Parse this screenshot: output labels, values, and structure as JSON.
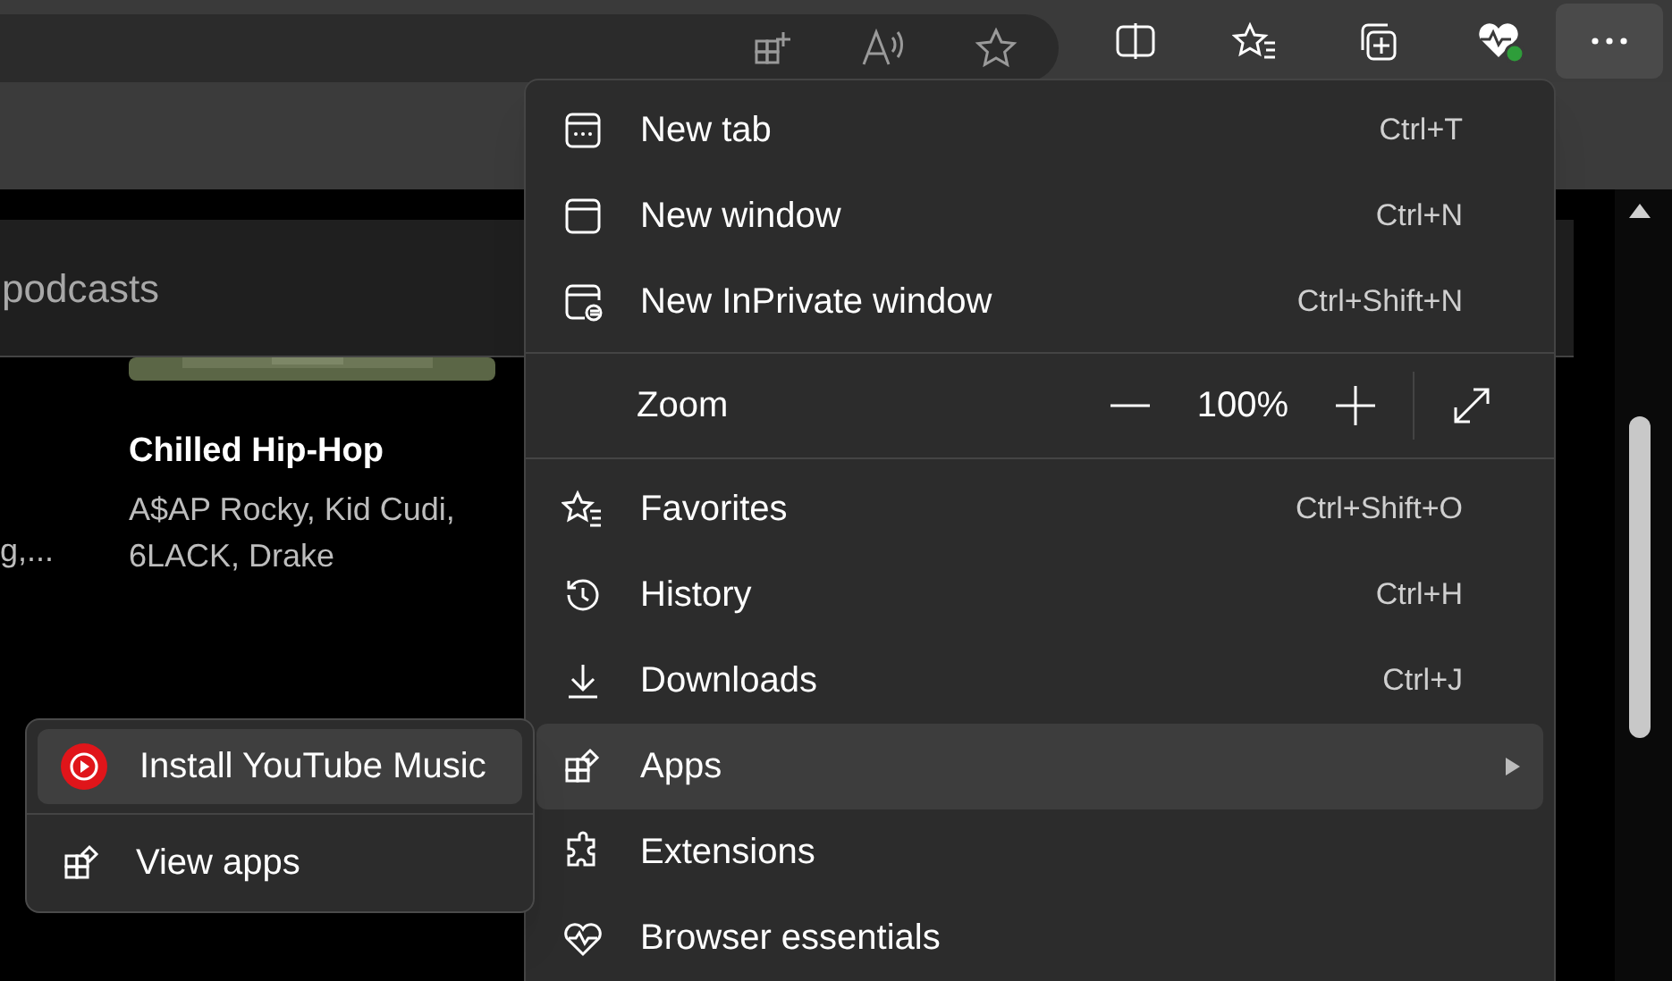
{
  "toolbar": {
    "more_button": {
      "selected": true
    }
  },
  "page": {
    "search_text": "podcasts",
    "cut_text": "g,...",
    "card": {
      "title": "Chilled Hip-Hop",
      "subtitle": "A$AP Rocky, Kid Cudi, 6LACK, Drake"
    }
  },
  "menu": {
    "groups": [
      [
        {
          "kind": "item",
          "label": "New tab",
          "shortcut": "Ctrl+T",
          "selected": false
        },
        {
          "kind": "item",
          "label": "New window",
          "shortcut": "Ctrl+N",
          "selected": false
        },
        {
          "kind": "item",
          "label": "New InPrivate window",
          "shortcut": "Ctrl+Shift+N",
          "selected": false
        }
      ],
      [
        {
          "kind": "zoom",
          "label": "Zoom",
          "value": "100%",
          "selected": false
        }
      ],
      [
        {
          "kind": "item",
          "label": "Favorites",
          "shortcut": "Ctrl+Shift+O",
          "selected": false
        },
        {
          "kind": "item",
          "label": "History",
          "shortcut": "Ctrl+H",
          "selected": false
        },
        {
          "kind": "item",
          "label": "Downloads",
          "shortcut": "Ctrl+J",
          "selected": false
        },
        {
          "kind": "submenu",
          "label": "Apps",
          "selected": true
        },
        {
          "kind": "item",
          "label": "Extensions",
          "selected": false
        },
        {
          "kind": "item",
          "label": "Browser essentials",
          "selected": false
        }
      ]
    ]
  },
  "submenu": {
    "groups": [
      [
        {
          "label": "Install YouTube Music",
          "selected": true
        }
      ],
      [
        {
          "label": "View apps",
          "selected": false
        }
      ]
    ]
  }
}
